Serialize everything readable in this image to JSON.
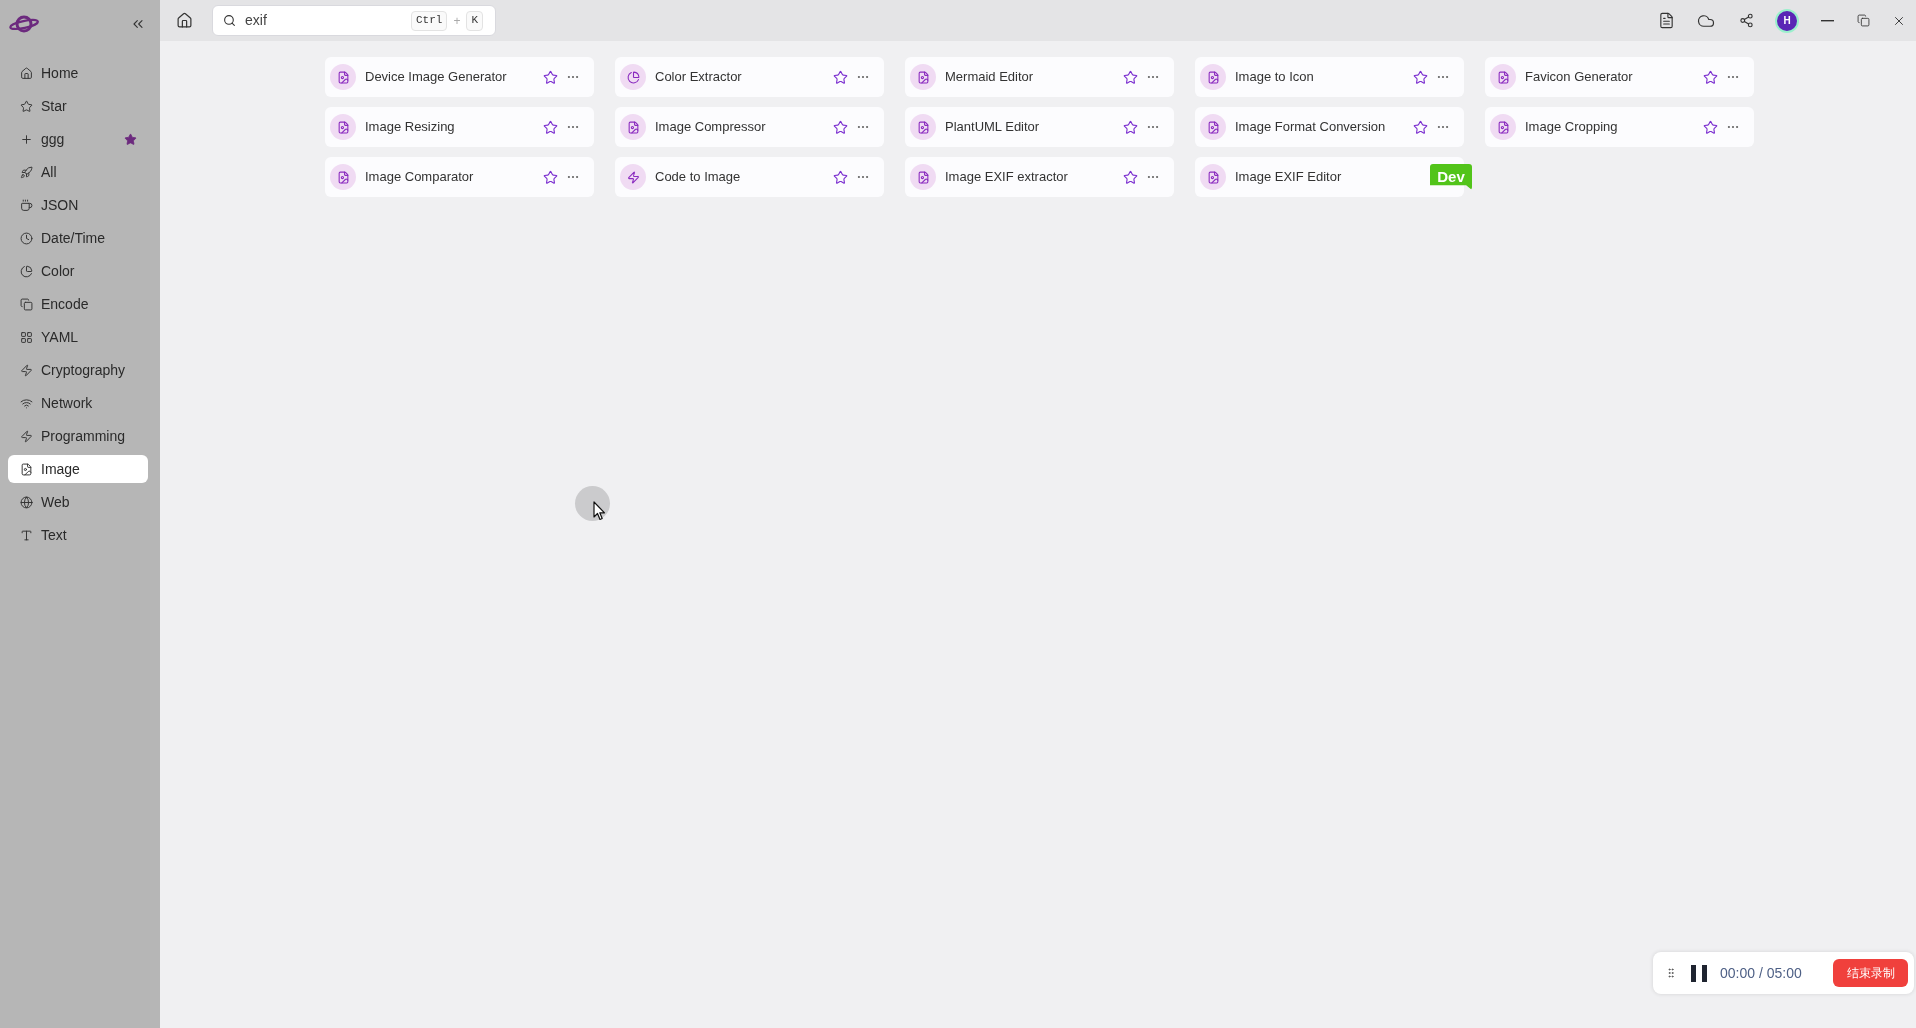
{
  "sidebar": {
    "items": [
      {
        "label": "Home",
        "selected": false,
        "starred": false
      },
      {
        "label": "Star",
        "selected": false,
        "starred": false
      },
      {
        "label": "ggg",
        "selected": false,
        "starred": true
      },
      {
        "label": "All",
        "selected": false,
        "starred": false
      },
      {
        "label": "JSON",
        "selected": false,
        "starred": false
      },
      {
        "label": "Date/Time",
        "selected": false,
        "starred": false
      },
      {
        "label": "Color",
        "selected": false,
        "starred": false
      },
      {
        "label": "Encode",
        "selected": false,
        "starred": false
      },
      {
        "label": "YAML",
        "selected": false,
        "starred": false
      },
      {
        "label": "Cryptography",
        "selected": false,
        "starred": false
      },
      {
        "label": "Network",
        "selected": false,
        "starred": false
      },
      {
        "label": "Programming",
        "selected": false,
        "starred": false
      },
      {
        "label": "Image",
        "selected": true,
        "starred": false
      },
      {
        "label": "Web",
        "selected": false,
        "starred": false
      },
      {
        "label": "Text",
        "selected": false,
        "starred": false
      }
    ]
  },
  "toolbar": {
    "search": {
      "value": "exif",
      "shortcut_keys": [
        "Ctrl",
        "K"
      ],
      "shortcut_joiner": "+"
    },
    "avatar": "H"
  },
  "tools": [
    {
      "name": "Device Image Generator",
      "starred": false
    },
    {
      "name": "Color Extractor",
      "starred": false
    },
    {
      "name": "Mermaid Editor",
      "starred": false
    },
    {
      "name": "Image to Icon",
      "starred": false
    },
    {
      "name": "Favicon Generator",
      "starred": false
    },
    {
      "name": "Image Resizing",
      "starred": false
    },
    {
      "name": "Image Compressor",
      "starred": false
    },
    {
      "name": "PlantUML Editor",
      "starred": false
    },
    {
      "name": "Image Format Conversion",
      "starred": false
    },
    {
      "name": "Image Cropping",
      "starred": false
    },
    {
      "name": "Image Comparator",
      "starred": false
    },
    {
      "name": "Code to Image",
      "starred": false
    },
    {
      "name": "Image EXIF extractor",
      "starred": false
    },
    {
      "name": "Image EXIF Editor",
      "badge": "Dev"
    }
  ],
  "recorder": {
    "time": "00:00 / 05:00",
    "stop_button": "结束录制"
  }
}
